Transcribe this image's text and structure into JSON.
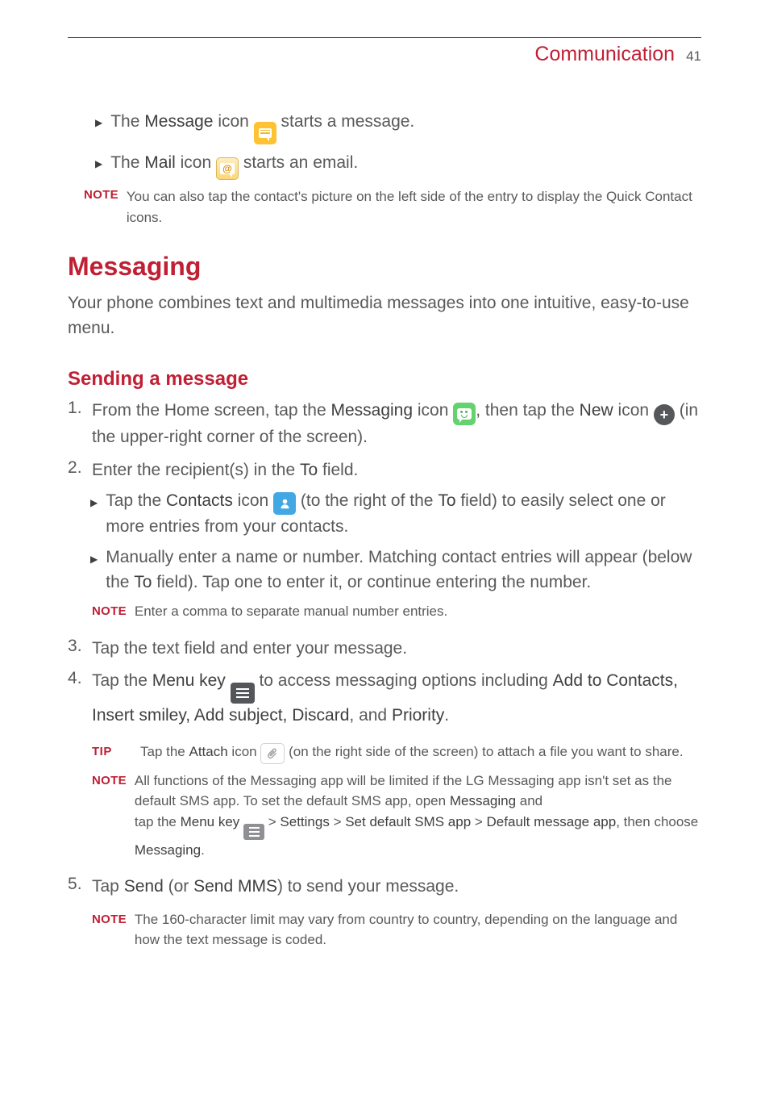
{
  "header": {
    "title": "Communication",
    "page": "41"
  },
  "intro_bullets": [
    {
      "pre": "The ",
      "bold": "Message",
      "mid": " icon ",
      "post": " starts a message.",
      "icon": "message"
    },
    {
      "pre": "The ",
      "bold": "Mail",
      "mid": " icon ",
      "post": " starts an email.",
      "icon": "mail"
    }
  ],
  "intro_note": {
    "label": "NOTE",
    "text": "You can also tap the contact's picture on the left side of the entry to display the Quick Contact icons."
  },
  "h1": "Messaging",
  "h1_body": "Your phone combines text and multimedia messages into one intuitive, easy-to-use menu.",
  "h2": "Sending a message",
  "step1": {
    "pre": "From the Home screen, tap the ",
    "bold1": "Messaging",
    "mid1": " icon ",
    "mid2": ", then tap the ",
    "bold2": "New",
    "mid3": " icon ",
    "post": " (in the upper-right corner of the screen)."
  },
  "step2": {
    "pre": "Enter the recipient(s) in the ",
    "bold": "To",
    "post": " field.",
    "sub1": {
      "pre": "Tap the ",
      "bold1": "Contacts",
      "mid1": " icon ",
      "mid2": " (to the right of the ",
      "bold2": "To",
      "post": " field) to easily select one or more entries from your contacts."
    },
    "sub2": {
      "pre": "Manually enter a name or number. Matching contact entries will appear (below the ",
      "bold": "To",
      "post": " field). Tap one to enter it, or continue entering the number."
    },
    "note": {
      "label": "NOTE",
      "text": "Enter a comma to separate manual number entries."
    }
  },
  "step3": "Tap the text field and enter your message.",
  "step4": {
    "pre": "Tap the ",
    "bold1": "Menu key",
    "mid": " to access messaging options including ",
    "bold2": "Add to Contacts, Insert smiley, Add subject, Discard",
    "mid2": ", and ",
    "bold3": "Priority",
    "post": ".",
    "tip": {
      "label": "TIP",
      "pre": "Tap the ",
      "bold": "Attach",
      "mid": " icon ",
      "post": " (on the right side of the screen) to attach a file you want to share."
    },
    "note": {
      "label": "NOTE",
      "line1_pre": "All functions of the Messaging app will be limited if the LG Messaging app isn't set as the default SMS app. To set the default SMS app, open ",
      "line1_bold": "Messaging",
      "line1_post": " and",
      "line2_pre": "tap the ",
      "line2_b1": "Menu key",
      "gt": " > ",
      "line2_b2": "Settings",
      "line2_b3": "Set default SMS app",
      "line2_b4": "Default message app",
      "line2_post": ", then choose ",
      "line2_b5": "Messaging",
      "line2_end": "."
    }
  },
  "step5": {
    "pre": "Tap ",
    "bold1": "Send",
    "mid": " (or ",
    "bold2": "Send MMS",
    "post": ") to send your message.",
    "note": {
      "label": "NOTE",
      "text": "The 160-character limit may vary from country to country, depending on the language and how the text message is coded."
    }
  }
}
